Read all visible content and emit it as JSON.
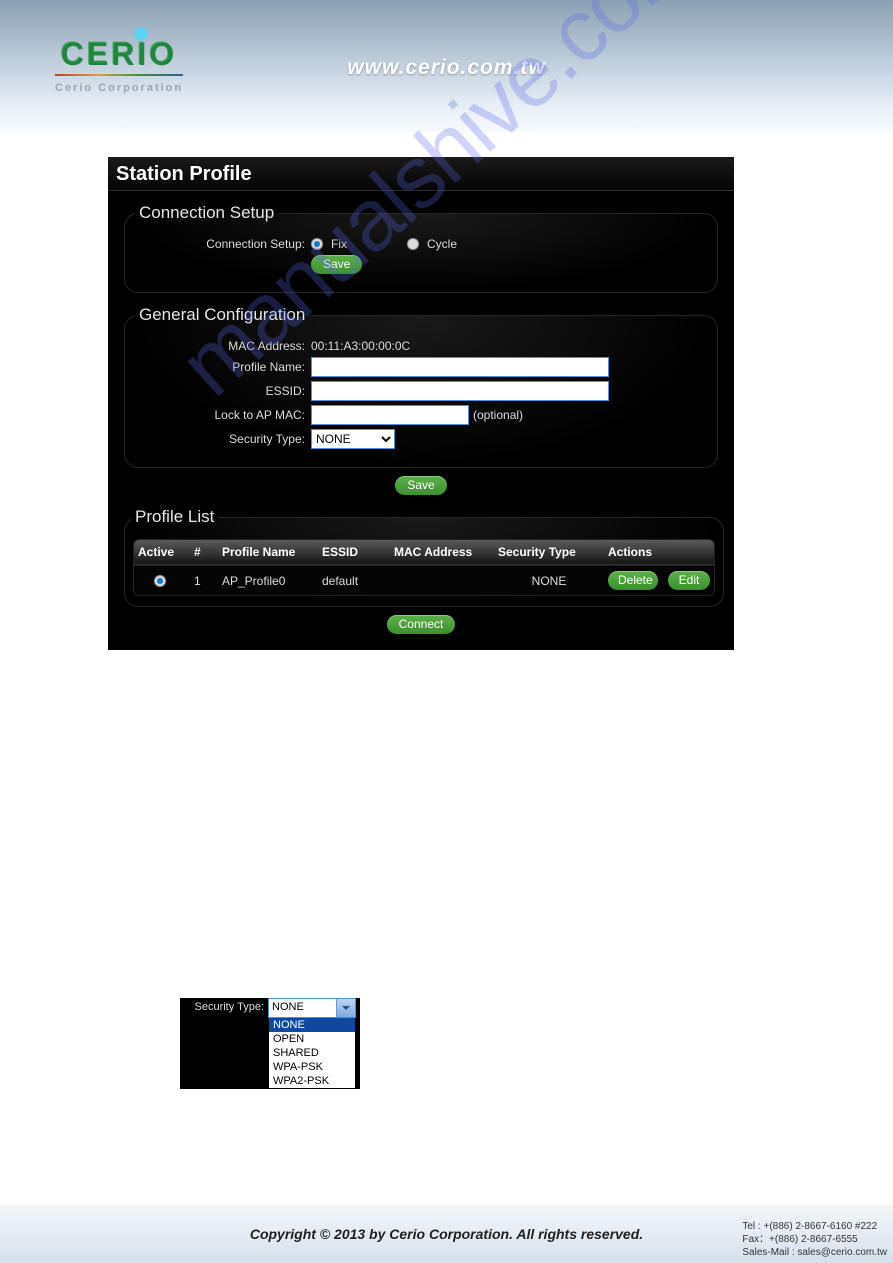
{
  "header": {
    "brand": "CERIO",
    "brand_sub": "Cerio Corporation",
    "url": "www.cerio.com.tw"
  },
  "panel": {
    "title": "Station Profile",
    "conn": {
      "legend": "Connection Setup",
      "label": "Connection Setup:",
      "fix": "Fix",
      "cycle": "Cycle",
      "save": "Save"
    },
    "gen": {
      "legend": "General Configuration",
      "mac_label": "MAC Address:",
      "mac_value": "00:11:A3:00:00:0C",
      "profile_label": "Profile Name:",
      "profile_value": "",
      "essid_label": "ESSID:",
      "essid_value": "",
      "lock_label": "Lock to AP MAC:",
      "lock_value": "",
      "lock_hint": "(optional)",
      "sectype_label": "Security Type:",
      "sectype_selected": "NONE",
      "save": "Save"
    },
    "list": {
      "legend": "Profile List",
      "cols": {
        "active": "Active",
        "num": "#",
        "profile": "Profile Name",
        "essid": "ESSID",
        "mac": "MAC Address",
        "sectype": "Security Type",
        "actions": "Actions"
      },
      "rows": [
        {
          "num": "1",
          "profile": "AP_Profile0",
          "essid": "default",
          "mac": "",
          "sectype": "NONE"
        }
      ],
      "delete": "Delete",
      "edit": "Edit",
      "connect": "Connect"
    }
  },
  "sectype_detail": {
    "label": "Security Type:",
    "selected": "NONE",
    "options": [
      "NONE",
      "OPEN",
      "SHARED",
      "WPA-PSK",
      "WPA2-PSK"
    ]
  },
  "watermark": "manualshive.com",
  "footer": {
    "copy": "Copyright © 2013 by Cerio Corporation. All rights reserved.",
    "tel": "Tel : +(886) 2-8667-6160 #222",
    "fax": "Fax：+(886) 2-8667-6555",
    "mail": "Sales-Mail : sales@cerio.com.tw"
  }
}
